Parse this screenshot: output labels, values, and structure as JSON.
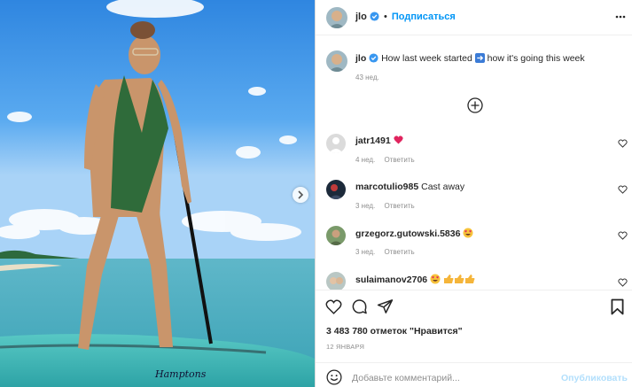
{
  "post": {
    "username": "jlo",
    "follow_label": "Подписаться",
    "caption_user": "jlo",
    "caption_text_a": "How last week started",
    "caption_text_b": "how it's going this week",
    "caption_arrow_icon": "right-arrow-emoji",
    "caption_time": "43 нед.",
    "likes": "3 483 780 отметок \"Нравится\"",
    "date": "12 ЯНВАРЯ",
    "add_comment_placeholder": "Добавьте комментарий...",
    "publish_label": "Опубликовать",
    "board_brand": "Hamptons"
  },
  "comments": [
    {
      "user": "jatr1491",
      "text": "",
      "emoji": "❤️",
      "time": "4 нед.",
      "reply": "Ответить"
    },
    {
      "user": "marcotulio985",
      "text": "Cast away",
      "emoji": "",
      "time": "3 нед.",
      "reply": "Ответить"
    },
    {
      "user": "grzegorz.gutowski.5836",
      "text": "",
      "emoji": "😍",
      "time": "3 нед.",
      "reply": "Ответить"
    },
    {
      "user": "sulaimanov2706",
      "text": "",
      "emoji": "😍👍👍👍",
      "time": "",
      "reply": ""
    }
  ],
  "colors": {
    "accent": "#0095f6",
    "heart": "#ed4956",
    "muted": "#8e8e8e"
  }
}
